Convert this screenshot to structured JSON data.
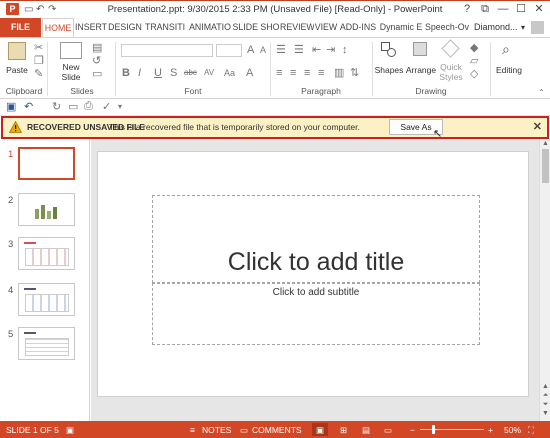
{
  "window": {
    "title": "Presentation2.ppt: 9/30/2015 2:33 PM (Unsaved File) [Read-Only] - PowerPoint",
    "app_icon": "P",
    "controls": [
      "?",
      "⧉",
      "—",
      "☐",
      "✕"
    ]
  },
  "tabs": [
    "FILE",
    "HOME",
    "INSERT",
    "DESIGN",
    "TRANSITI",
    "ANIMATIO",
    "SLIDE SHO",
    "REVIEW",
    "VIEW",
    "ADD-INS",
    "Dynamic E",
    "Speech-Ov"
  ],
  "active_tab": "HOME",
  "user": "Diamond...",
  "ribbon": {
    "groups": {
      "clipboard": "Clipboard",
      "slides": "Slides",
      "font": "Font",
      "paragraph": "Paragraph",
      "drawing": "Drawing"
    },
    "paste_label": "Paste",
    "new_slide_label": "New\nSlide",
    "shapes_label": "Shapes",
    "arrange_label": "Arrange",
    "quick_styles_label": "Quick\nStyles",
    "editing_label": "Editing",
    "font_buttons": [
      "B",
      "I",
      "U",
      "S",
      "abc",
      "AV",
      "Aa",
      "A"
    ]
  },
  "recovered_bar": {
    "heading": "RECOVERED UNSAVED FILE",
    "message": "This is a recovered file that is temporarily stored on your computer.",
    "button": "Save As"
  },
  "thumbnails": [
    {
      "number": "1",
      "selected": true
    },
    {
      "number": "2",
      "selected": false
    },
    {
      "number": "3",
      "selected": false
    },
    {
      "number": "4",
      "selected": false
    },
    {
      "number": "5",
      "selected": false
    }
  ],
  "slide": {
    "title_placeholder": "Click to add title",
    "subtitle_placeholder": "Click to add subtitle"
  },
  "status": {
    "slide_info": "SLIDE 1 OF 5",
    "notes": "NOTES",
    "comments": "COMMENTS",
    "zoom": "50%"
  },
  "colors": {
    "accent": "#d24726",
    "recovered_bg": "#fcf1c4",
    "recovered_border": "#cc1f1f"
  }
}
